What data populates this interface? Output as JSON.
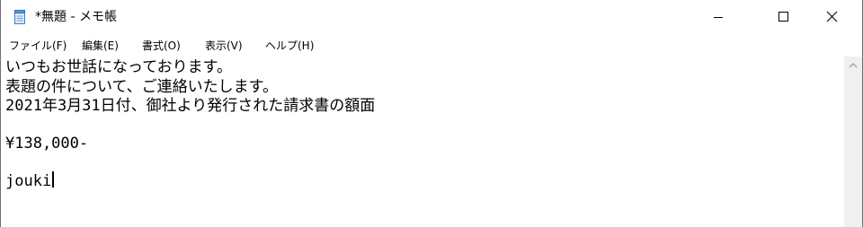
{
  "window": {
    "title": "*無題 - メモ帳",
    "icon": "notepad-icon"
  },
  "caption_buttons": {
    "minimize": "minimize-icon",
    "maximize": "maximize-icon",
    "close": "close-icon"
  },
  "menu": {
    "items": [
      {
        "label": "ファイル(F)"
      },
      {
        "label": "編集(E)"
      },
      {
        "label": "書式(O)"
      },
      {
        "label": "表示(V)"
      },
      {
        "label": "ヘルプ(H)"
      }
    ]
  },
  "editor": {
    "lines": [
      "いつもお世話になっております。",
      "表題の件について、ご連絡いたします。",
      "2021年3月31日付、御社より発行された請求書の額面",
      "",
      "¥138,000-",
      "",
      "jouki"
    ]
  },
  "scrollbar": {
    "up_arrow": "scroll-up-arrow-icon"
  },
  "colors": {
    "background": "#ffffff",
    "scrollbar_track": "#f0f0f0",
    "text": "#000000"
  }
}
